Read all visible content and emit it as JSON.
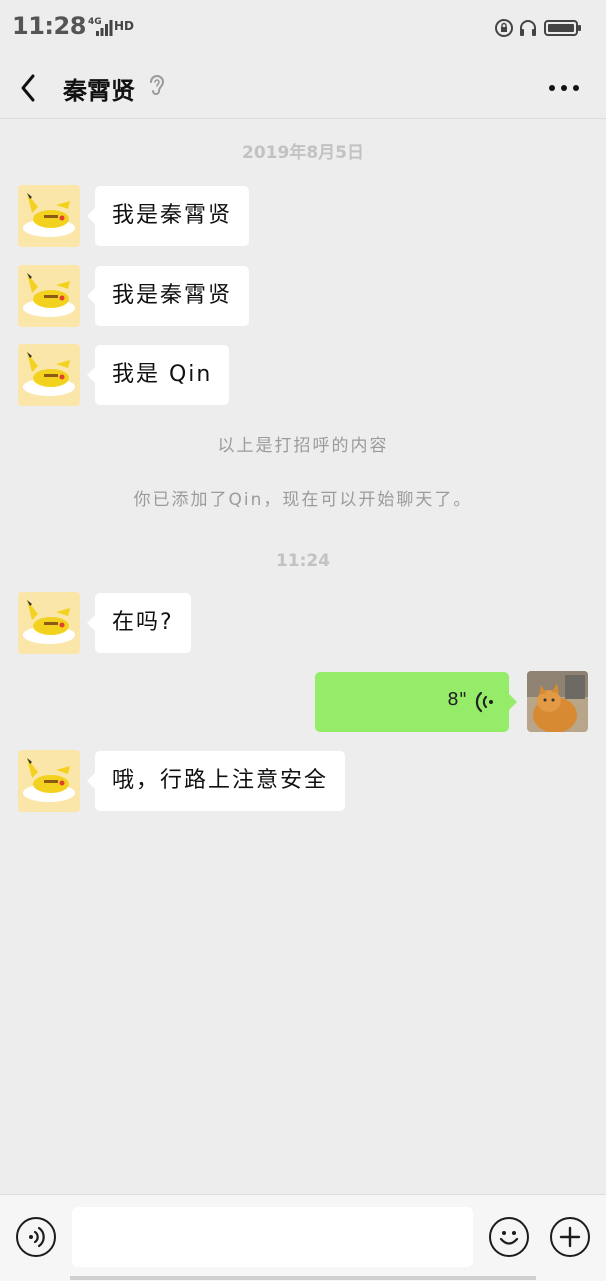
{
  "status_bar": {
    "time": "11:28",
    "network": "4G",
    "hd": "HD"
  },
  "header": {
    "title": "秦霄贤",
    "back_icon": "chevron-left-icon",
    "earpiece_icon": "ear-icon",
    "more_icon": "more-dots-icon"
  },
  "chat": {
    "date_label": "2019年8月5日",
    "greetings": [
      {
        "text": "我是秦霄贤"
      },
      {
        "text": "我是秦霄贤"
      },
      {
        "text": "我是 Qin"
      }
    ],
    "system_messages": [
      "以上是打招呼的内容",
      "你已添加了Qin，现在可以开始聊天了。"
    ],
    "time_label": "11:24",
    "message_question": "在吗?",
    "voice_message": {
      "duration": "8\"",
      "icon": "voice-wave-icon"
    },
    "message_reply": "哦，行路上注意安全"
  },
  "input_bar": {
    "voice_icon": "voice-mode-icon",
    "input_value": "",
    "emoji_icon": "emoji-icon",
    "plus_icon": "plus-icon"
  },
  "colors": {
    "background": "#ededed",
    "incoming_bubble": "#ffffff",
    "outgoing_bubble": "#95ec69",
    "system_text": "#9b9b9b"
  }
}
